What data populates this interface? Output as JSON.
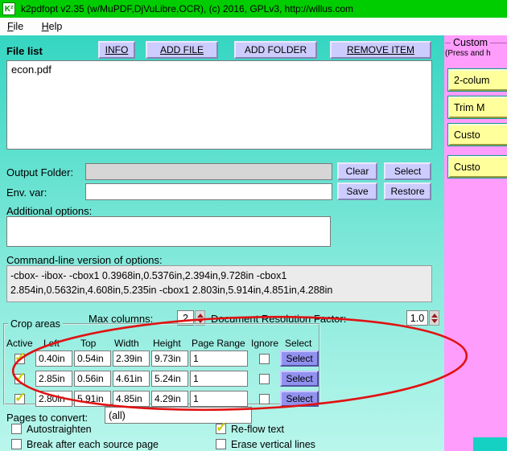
{
  "window": {
    "title": "k2pdfopt v2.35 (w/MuPDF,DjVuLibre,OCR), (c) 2016, GPLv3, http://willus.com"
  },
  "icons": {
    "app_icon": "K²",
    "check_mark": "✓",
    "spinner_up": "▲",
    "spinner_down": "▼"
  },
  "menu": {
    "items": [
      "File",
      "Help"
    ]
  },
  "file_section": {
    "label": "File list",
    "info_button": "INFO",
    "add_file_button": "ADD FILE",
    "add_folder_button": "ADD FOLDER",
    "remove_item_button": "REMOVE ITEM",
    "files": [
      "econ.pdf"
    ]
  },
  "output_folder": {
    "label": "Output Folder:",
    "value": "",
    "clear_button": "Clear",
    "select_button": "Select"
  },
  "env_var": {
    "label": "Env. var:",
    "value": "",
    "save_button": "Save",
    "restore_button": "Restore"
  },
  "additional_options": {
    "label": "Additional options:",
    "value": ""
  },
  "command_line": {
    "label": "Command-line version of options:",
    "value": "-cbox- -ibox- -cbox1 0.3968in,0.5376in,2.394in,9.728in -cbox1 2.854in,0.5632in,4.608in,5.235in -cbox1 2.803in,5.914in,4.851in,4.288in"
  },
  "settings": {
    "max_columns_label": "Max columns:",
    "max_columns_value": "2",
    "doc_resolution_label": "Document Resolution Factor:",
    "doc_resolution_value": "1.0"
  },
  "crop_areas": {
    "legend": "Crop areas",
    "headers": {
      "active": "Active",
      "left": "Left",
      "top": "Top",
      "width": "Width",
      "height": "Height",
      "page_range": "Page Range",
      "ignore": "Ignore",
      "select": "Select"
    },
    "select_button": "Select",
    "rows": [
      {
        "active": true,
        "left": "0.40in",
        "top": "0.54in",
        "width": "2.39in",
        "height": "9.73in",
        "page_range": "1",
        "ignore": false
      },
      {
        "active": true,
        "left": "2.85in",
        "top": "0.56in",
        "width": "4.61in",
        "height": "5.24in",
        "page_range": "1",
        "ignore": false
      },
      {
        "active": true,
        "left": "2.80in",
        "top": "5.91in",
        "width": "4.85in",
        "height": "4.29in",
        "page_range": "1",
        "ignore": false
      }
    ]
  },
  "pages_to_convert": {
    "label": "Pages to convert:",
    "value": "(all)"
  },
  "checkboxes": {
    "autostraighten": {
      "label": "Autostraighten",
      "checked": false
    },
    "break_after_page": {
      "label": "Break after each source page",
      "checked": false
    },
    "reflow_text": {
      "label": "Re-flow text",
      "checked": true
    },
    "erase_vertical_lines": {
      "label": "Erase vertical lines",
      "checked": false
    }
  },
  "presets_panel": {
    "legend": "Custom",
    "subtext": "(Press and h",
    "buttons": [
      "2-colum",
      "Trim M",
      "Custo",
      "Custo"
    ]
  },
  "colors": {
    "title_bar_green": "#00cd00",
    "background_top": "#35d6c2",
    "background_bottom": "#b9f6ec",
    "button_lavender": "#ccccff",
    "button_blue": "#9191f0",
    "button_yellow": "#ffff9c",
    "panel_pink": "#ff9dfd",
    "annotation_red": "#e01212",
    "check_mark_yellow": "#c9cd00",
    "spinner_arrow_maroon": "#9b1c1c"
  }
}
